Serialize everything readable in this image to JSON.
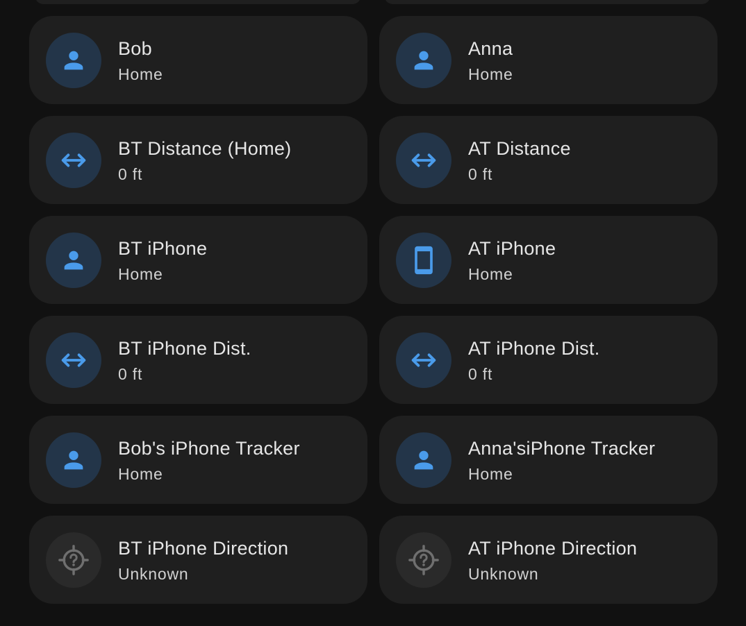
{
  "colors": {
    "background": "#111111",
    "card": "#1f1f1f",
    "icon_active": "#4a9bea",
    "icon_badge_active": "#233549",
    "icon_inactive": "#6f6f6f",
    "icon_badge_inactive": "#2a2a2a"
  },
  "cards": [
    {
      "name": "Bob",
      "state": "Home",
      "icon": "person-icon"
    },
    {
      "name": "Anna",
      "state": "Home",
      "icon": "person-icon"
    },
    {
      "name": "BT Distance (Home)",
      "state": "0 ft",
      "icon": "arrow-left-right-icon"
    },
    {
      "name": "AT Distance",
      "state": "0 ft",
      "icon": "arrow-left-right-icon"
    },
    {
      "name": "BT iPhone",
      "state": "Home",
      "icon": "person-icon"
    },
    {
      "name": "AT iPhone",
      "state": "Home",
      "icon": "cellphone-icon"
    },
    {
      "name": "BT iPhone Dist.",
      "state": "0 ft",
      "icon": "arrow-left-right-icon"
    },
    {
      "name": "AT iPhone Dist.",
      "state": "0 ft",
      "icon": "arrow-left-right-icon"
    },
    {
      "name": "Bob's iPhone Tracker",
      "state": "Home",
      "icon": "person-icon"
    },
    {
      "name": "Anna'siPhone Tracker",
      "state": "Home",
      "icon": "person-icon"
    },
    {
      "name": "BT iPhone Direction",
      "state": "Unknown",
      "icon": "crosshairs-question-icon"
    },
    {
      "name": "AT iPhone Direction",
      "state": "Unknown",
      "icon": "crosshairs-question-icon"
    }
  ]
}
